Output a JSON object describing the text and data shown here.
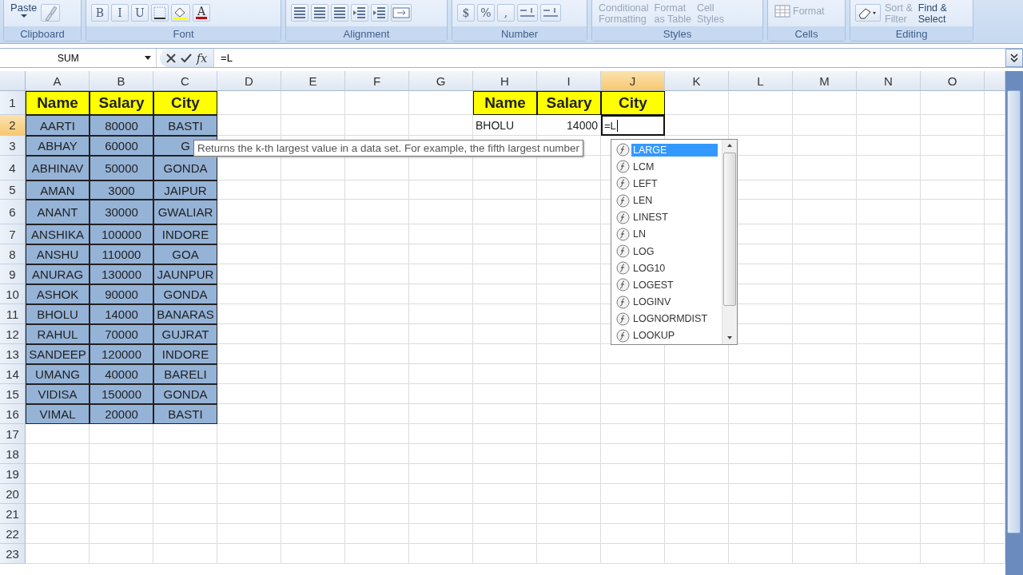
{
  "ribbon": {
    "groups": [
      {
        "label": "Clipboard",
        "buttons": [
          {
            "kind": "paste",
            "text": "Paste"
          },
          {
            "kind": "brush"
          }
        ]
      },
      {
        "label": "Font",
        "buttons": [
          {
            "kind": "glyph",
            "text": "B"
          },
          {
            "kind": "glyph",
            "text": "I"
          },
          {
            "kind": "glyph",
            "text": "U"
          },
          {
            "kind": "border"
          },
          {
            "kind": "fill"
          },
          {
            "kind": "fontcolor",
            "text": "A"
          }
        ]
      },
      {
        "label": "Alignment",
        "buttons": [
          {
            "kind": "align"
          },
          {
            "kind": "align"
          },
          {
            "kind": "align"
          },
          {
            "kind": "indent"
          },
          {
            "kind": "indent"
          },
          {
            "kind": "merge"
          }
        ]
      },
      {
        "label": "Number",
        "buttons": [
          {
            "kind": "glyph",
            "text": "$"
          },
          {
            "kind": "glyph",
            "text": "%"
          },
          {
            "kind": "glyph",
            "text": ","
          },
          {
            "kind": "decimal"
          },
          {
            "kind": "decimal"
          }
        ]
      },
      {
        "label": "Styles",
        "buttons": [
          {
            "kind": "stack",
            "lines": [
              "Conditional",
              "Formatting"
            ],
            "disabled": true
          },
          {
            "kind": "stack",
            "lines": [
              "Format",
              "as Table"
            ],
            "disabled": true
          },
          {
            "kind": "stack",
            "lines": [
              "Cell",
              "Styles"
            ],
            "disabled": true
          }
        ]
      },
      {
        "label": "Cells",
        "buttons": [
          {
            "kind": "cellformat",
            "lines": [
              "Format"
            ],
            "disabled": true
          }
        ]
      },
      {
        "label": "Editing",
        "buttons": [
          {
            "kind": "eraser"
          },
          {
            "kind": "stack",
            "lines": [
              "Sort &",
              "Filter"
            ],
            "disabled": true
          },
          {
            "kind": "stack",
            "lines": [
              "Find &",
              "Select"
            ],
            "disabled": false
          }
        ]
      }
    ]
  },
  "formula_bar": {
    "name_box": "SUM",
    "function_button": "fx",
    "value": "=L"
  },
  "sheet": {
    "columns": [
      {
        "label": "A",
        "selected": false
      },
      {
        "label": "B",
        "selected": false
      },
      {
        "label": "C",
        "selected": false
      },
      {
        "label": "D",
        "selected": false
      },
      {
        "label": "E",
        "selected": false
      },
      {
        "label": "F",
        "selected": false
      },
      {
        "label": "G",
        "selected": false
      },
      {
        "label": "H",
        "selected": false
      },
      {
        "label": "I",
        "selected": false
      },
      {
        "label": "J",
        "selected": true
      },
      {
        "label": "K",
        "selected": false
      },
      {
        "label": "L",
        "selected": false
      },
      {
        "label": "M",
        "selected": false
      },
      {
        "label": "N",
        "selected": false
      },
      {
        "label": "O",
        "selected": false
      }
    ],
    "rows": [
      {
        "label": "1",
        "selected": false
      },
      {
        "label": "2",
        "selected": true
      },
      {
        "label": "3",
        "selected": false
      },
      {
        "label": "4",
        "selected": false
      },
      {
        "label": "5",
        "selected": false
      },
      {
        "label": "6",
        "selected": false
      },
      {
        "label": "7",
        "selected": false
      },
      {
        "label": "8",
        "selected": false
      },
      {
        "label": "9",
        "selected": false
      },
      {
        "label": "10",
        "selected": false
      },
      {
        "label": "11",
        "selected": false
      },
      {
        "label": "12",
        "selected": false
      },
      {
        "label": "13",
        "selected": false
      },
      {
        "label": "14",
        "selected": false
      },
      {
        "label": "15",
        "selected": false
      },
      {
        "label": "16",
        "selected": false
      },
      {
        "label": "17",
        "selected": false
      },
      {
        "label": "18",
        "selected": false
      },
      {
        "label": "19",
        "selected": false
      },
      {
        "label": "20",
        "selected": false
      },
      {
        "label": "21",
        "selected": false
      },
      {
        "label": "22",
        "selected": false
      },
      {
        "label": "23",
        "selected": false
      }
    ],
    "left_table": {
      "header": [
        "Name",
        "Salary",
        "City"
      ],
      "rows": [
        [
          "AARTI",
          "80000",
          "BASTI"
        ],
        [
          "ABHAY",
          "60000",
          "G"
        ],
        [
          "ABHINAV",
          "50000",
          "GONDA"
        ],
        [
          "AMAN",
          "3000",
          "JAIPUR"
        ],
        [
          "ANANT",
          "30000",
          "GWALIAR"
        ],
        [
          "ANSHIKA",
          "100000",
          "INDORE"
        ],
        [
          "ANSHU",
          "110000",
          "GOA"
        ],
        [
          "ANURAG",
          "130000",
          "JAUNPUR"
        ],
        [
          "ASHOK",
          "90000",
          "GONDA"
        ],
        [
          "BHOLU",
          "14000",
          "BANARAS"
        ],
        [
          "RAHUL",
          "70000",
          "GUJRAT"
        ],
        [
          "SANDEEP",
          "120000",
          "INDORE"
        ],
        [
          "UMANG",
          "40000",
          "BARELI"
        ],
        [
          "VIDISA",
          "150000",
          "GONDA"
        ],
        [
          "VIMAL",
          "20000",
          "BASTI"
        ]
      ]
    },
    "right_table": {
      "header": [
        "Name",
        "Salary",
        "City"
      ],
      "rows": [
        [
          "BHOLU",
          "14000"
        ]
      ],
      "active_cell": "=L"
    }
  },
  "tooltip": "Returns the k-th largest value in a data set. For example, the fifth largest number",
  "autocomplete": [
    {
      "text": "LARGE",
      "selected": true
    },
    {
      "text": "LCM",
      "selected": false
    },
    {
      "text": "LEFT",
      "selected": false
    },
    {
      "text": "LEN",
      "selected": false
    },
    {
      "text": "LINEST",
      "selected": false
    },
    {
      "text": "LN",
      "selected": false
    },
    {
      "text": "LOG",
      "selected": false
    },
    {
      "text": "LOG10",
      "selected": false
    },
    {
      "text": "LOGEST",
      "selected": false
    },
    {
      "text": "LOGINV",
      "selected": false
    },
    {
      "text": "LOGNORMDIST",
      "selected": false
    },
    {
      "text": "LOOKUP",
      "selected": false
    }
  ]
}
